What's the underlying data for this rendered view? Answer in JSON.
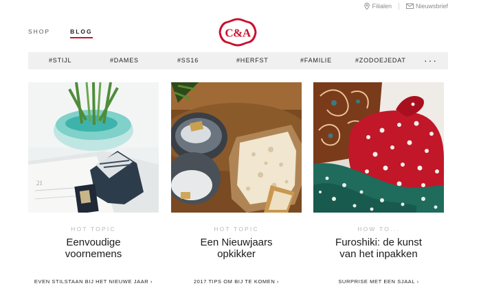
{
  "utility": {
    "stores_label": "Filialen",
    "newsletter_label": "Nieuwsbrief"
  },
  "nav": {
    "shop_label": "SHOP",
    "blog_label": "BLOG"
  },
  "logo": {
    "text": "C&A",
    "color": "#c8102e"
  },
  "tags": [
    "#STIJL",
    "#DAMES",
    "#SS16",
    "#HERFST",
    "#FAMILIE",
    "#ZODOEJEDAT"
  ],
  "tags_more": "···",
  "articles": [
    {
      "category": "HOT TOPIC",
      "title_line1": "Eenvoudige",
      "title_line2": "voornemens",
      "link": "EVEN STILSTAAN BIJ HET NIEUWE JAAR ›",
      "image_icon": "calendar-photo"
    },
    {
      "category": "HOT TOPIC",
      "title_line1": "Een Nieuwjaars",
      "title_line2": "opkikker",
      "link": "2017 TIPS OM BIJ TE KOMEN ›",
      "image_icon": "herring-bread-photo"
    },
    {
      "category": "HOW TO...",
      "title_line1": "Furoshiki: de kunst",
      "title_line2": "van het inpakken",
      "link": "SURPRISE MET EEN SJAAL ›",
      "image_icon": "wrapped-gift-photo"
    }
  ]
}
